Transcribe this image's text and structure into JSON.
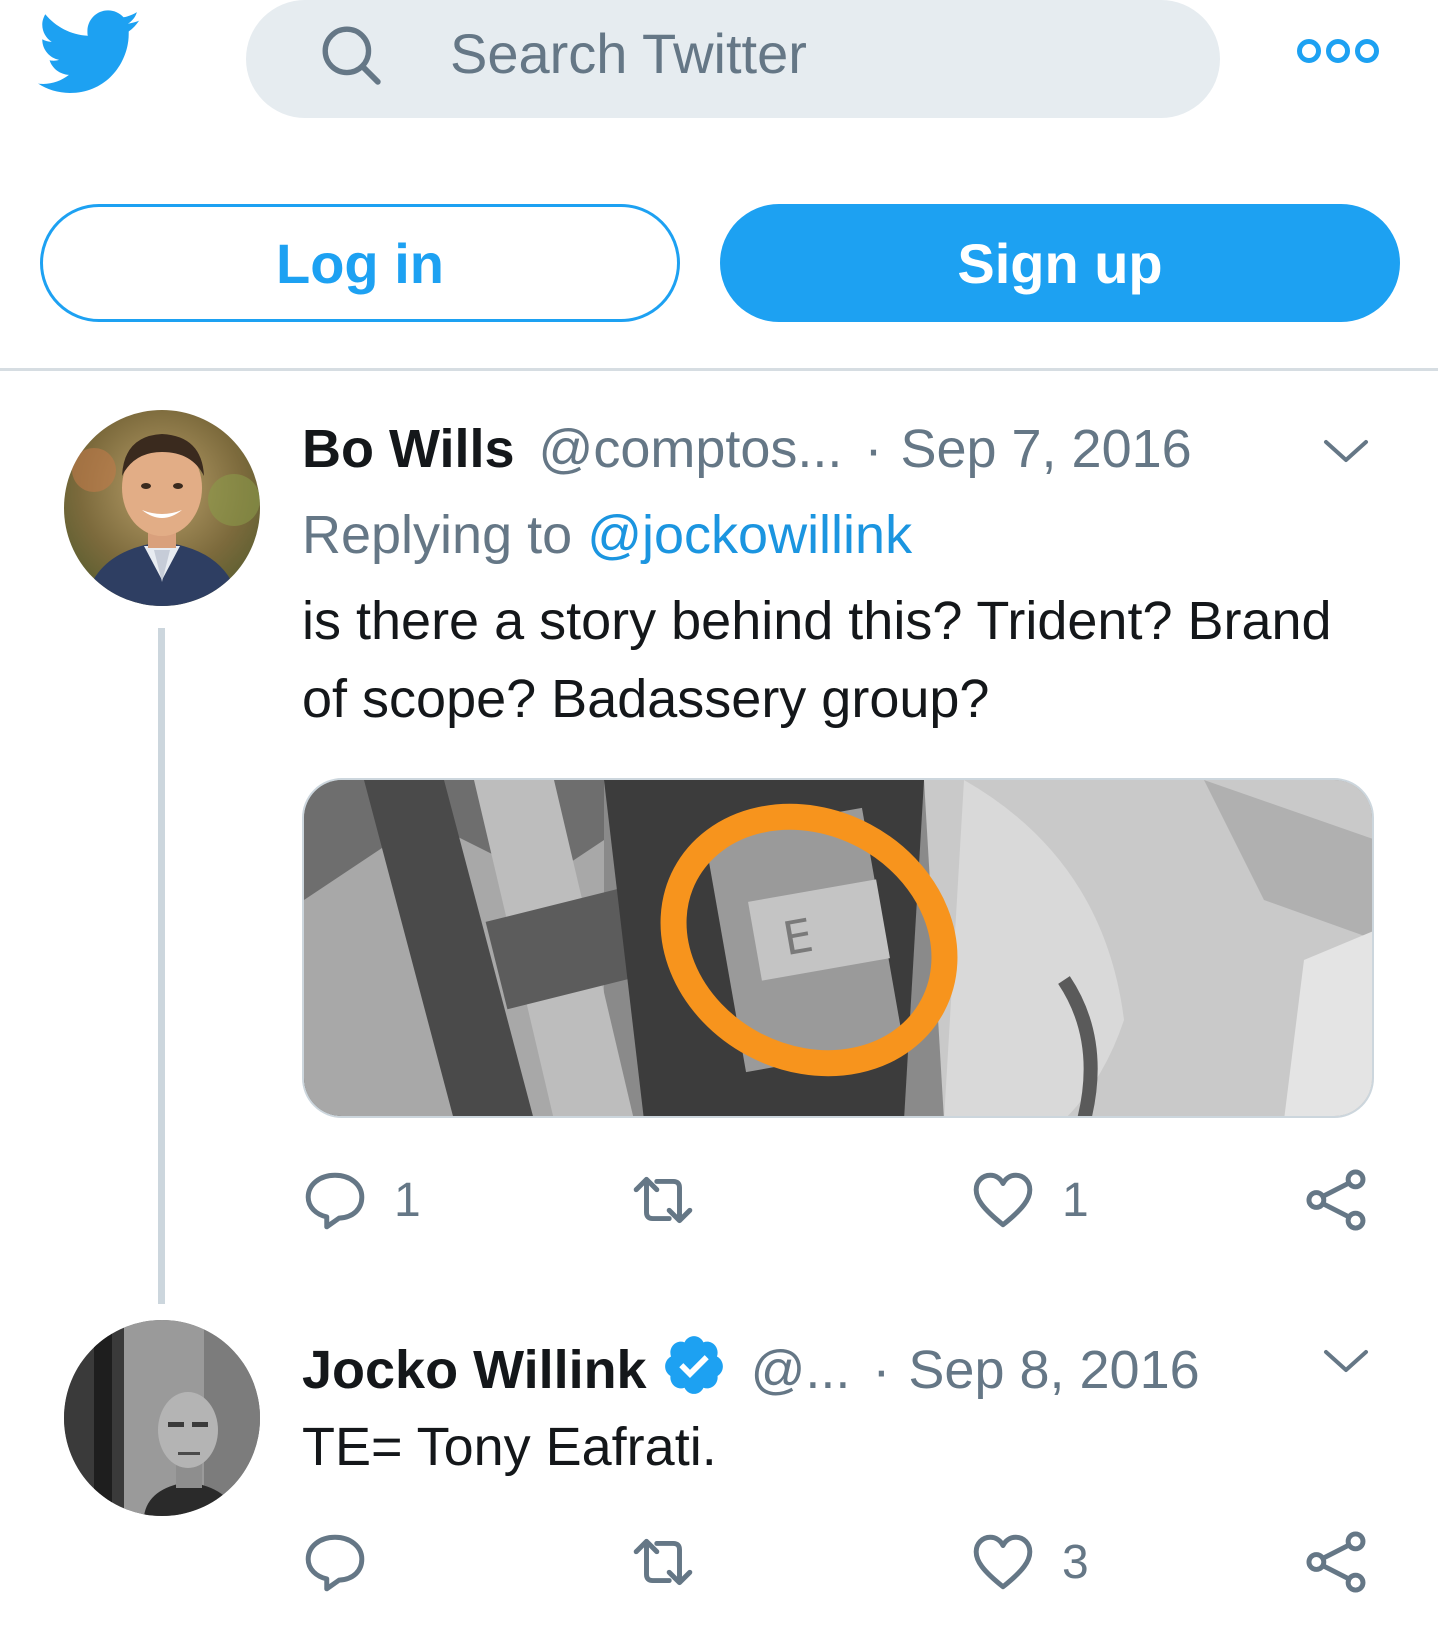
{
  "header": {
    "search_placeholder": "Search Twitter"
  },
  "auth": {
    "login_label": "Log in",
    "signup_label": "Sign up"
  },
  "colors": {
    "brand": "#1da1f2",
    "muted": "#657786",
    "search_bg": "#e6ecf0"
  },
  "tweets": [
    {
      "name": "Bo Wills",
      "handle": "@comptos...",
      "separator": "·",
      "date": "Sep 7, 2016",
      "replying_prefix": "Replying to",
      "replying_to": "@jockowillink",
      "text": "is there a story behind this? Trident? Brand of scope? Badassery group?",
      "reply_count": "1",
      "retweet_count": "",
      "like_count": "1",
      "has_media": true
    },
    {
      "name": "Jocko Willink",
      "verified": true,
      "handle": "@...",
      "separator": "·",
      "date": "Sep 8, 2016",
      "text": "TE= Tony Eafrati.",
      "reply_count": "",
      "retweet_count": "",
      "like_count": "3"
    }
  ]
}
